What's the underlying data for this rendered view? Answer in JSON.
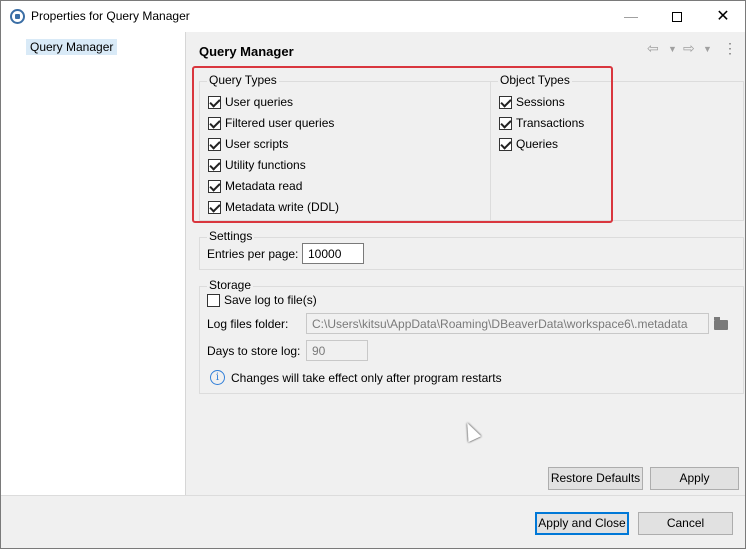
{
  "window": {
    "title": "Properties for Query Manager"
  },
  "tree": {
    "items": [
      {
        "label": "Query Manager"
      }
    ]
  },
  "page": {
    "title": "Query Manager"
  },
  "query_types": {
    "label": "Query Types",
    "items": [
      {
        "label": "User queries",
        "checked": true
      },
      {
        "label": "Filtered user queries",
        "checked": true
      },
      {
        "label": "User scripts",
        "checked": true
      },
      {
        "label": "Utility functions",
        "checked": true
      },
      {
        "label": "Metadata read",
        "checked": true
      },
      {
        "label": "Metadata write (DDL)",
        "checked": true
      }
    ]
  },
  "object_types": {
    "label": "Object Types",
    "items": [
      {
        "label": "Sessions",
        "checked": true
      },
      {
        "label": "Transactions",
        "checked": true
      },
      {
        "label": "Queries",
        "checked": true
      }
    ]
  },
  "settings": {
    "label": "Settings",
    "entries_label": "Entries per page:",
    "entries_value": "10000"
  },
  "storage": {
    "label": "Storage",
    "save_log_label": "Save log to file(s)",
    "save_log_checked": false,
    "folder_label": "Log files folder:",
    "folder_value": "C:\\Users\\kitsu\\AppData\\Roaming\\DBeaverData\\workspace6\\.metadata",
    "days_label": "Days to store log:",
    "days_value": "90",
    "info_text": "Changes will take effect only after program restarts"
  },
  "buttons": {
    "restore": "Restore Defaults",
    "apply": "Apply",
    "apply_close": "Apply and Close",
    "cancel": "Cancel"
  },
  "colors": {
    "highlight": "#d9363e",
    "selection": "#d9eaf7",
    "primary_border": "#0078d7"
  }
}
